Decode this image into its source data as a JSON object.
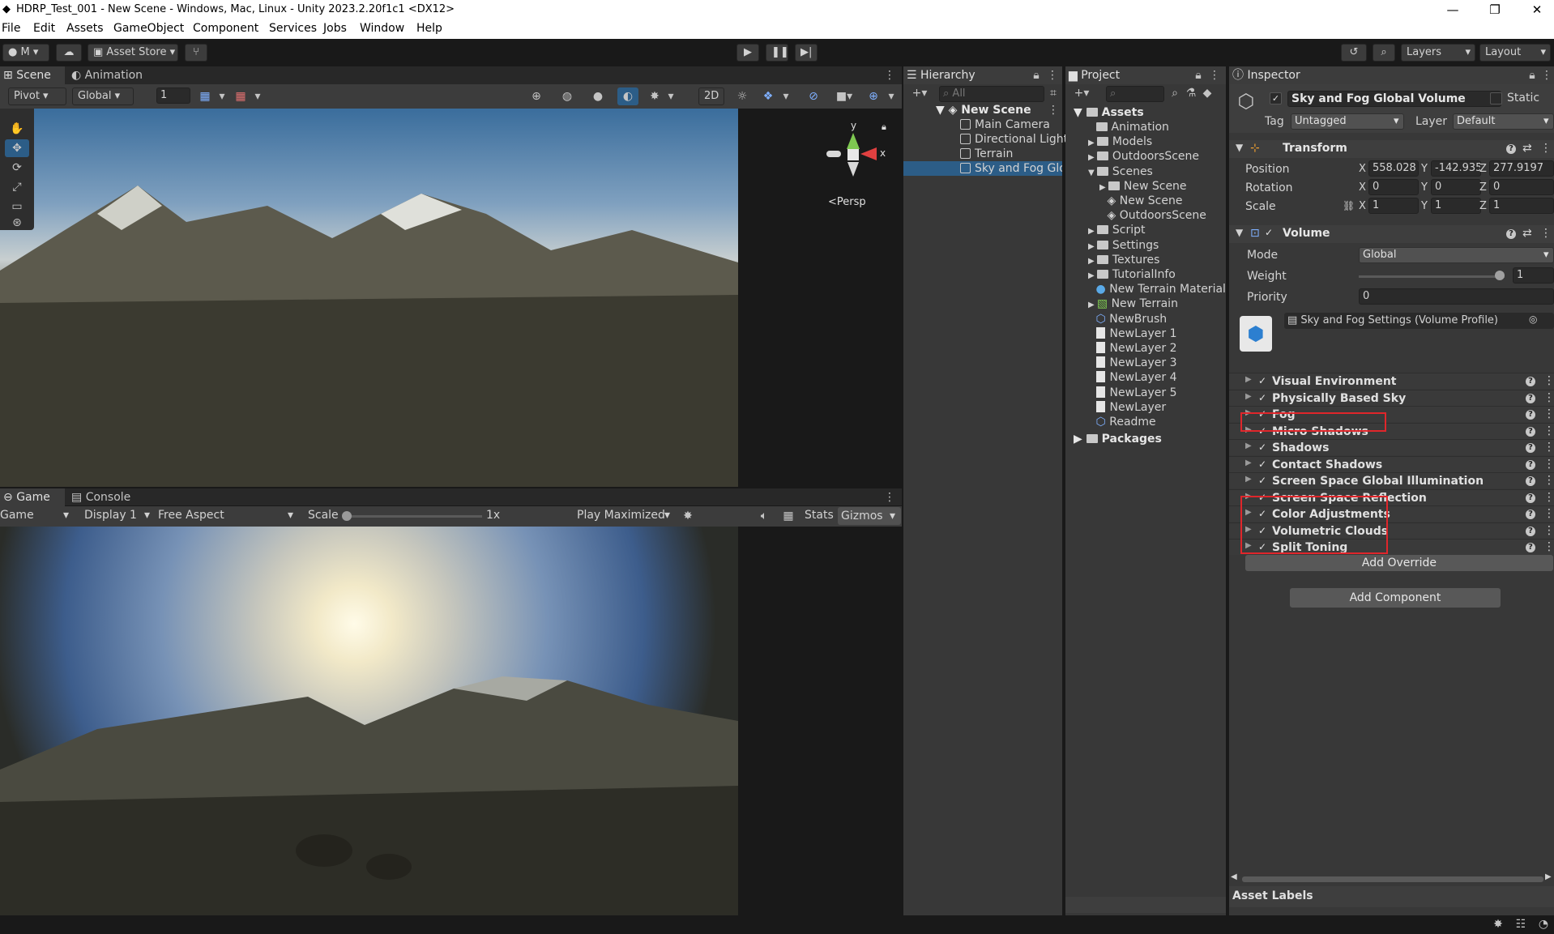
{
  "window": {
    "title": "HDRP_Test_001 - New Scene - Windows, Mac, Linux - Unity 2023.2.20f1c1 <DX12>",
    "minimize": "—",
    "maximize": "❐",
    "close": "✕"
  },
  "menu": [
    "File",
    "Edit",
    "Assets",
    "GameObject",
    "Component",
    "Services",
    "Jobs",
    "Window",
    "Help"
  ],
  "toolbar": {
    "account": "M",
    "asset_store": "Asset Store",
    "layers": "Layers",
    "layout": "Layout"
  },
  "scene": {
    "tab_scene": "Scene",
    "tab_animation": "Animation",
    "pivot": "Pivot",
    "global": "Global",
    "grid_value": "1",
    "mode_2d": "2D",
    "persp": "Persp",
    "gizmo_y": "y",
    "gizmo_x": "x"
  },
  "game": {
    "tab_game": "Game",
    "tab_console": "Console",
    "game_dd": "Game",
    "display": "Display 1",
    "aspect": "Free Aspect",
    "scale_label": "Scale",
    "scale_value": "1x",
    "play_mode": "Play Maximized",
    "stats": "Stats",
    "gizmos": "Gizmos"
  },
  "hierarchy": {
    "title": "Hierarchy",
    "search_placeholder": "All",
    "scene": "New Scene",
    "items": [
      "Main Camera",
      "Directional Light",
      "Terrain",
      "Sky and Fog Glol"
    ]
  },
  "project": {
    "title": "Project",
    "root": "Assets",
    "packages": "Packages",
    "items": [
      {
        "label": "Animation",
        "type": "folder",
        "indent": 1
      },
      {
        "label": "Models",
        "type": "folder",
        "indent": 1
      },
      {
        "label": "OutdoorsScene",
        "type": "folder",
        "indent": 1
      },
      {
        "label": "Scenes",
        "type": "folder",
        "indent": 1
      },
      {
        "label": "New Scene",
        "type": "folder",
        "indent": 2
      },
      {
        "label": "New Scene",
        "type": "scene",
        "indent": 2
      },
      {
        "label": "OutdoorsScene",
        "type": "scene",
        "indent": 2
      },
      {
        "label": "Script",
        "type": "folder",
        "indent": 1
      },
      {
        "label": "Settings",
        "type": "folder",
        "indent": 1
      },
      {
        "label": "Textures",
        "type": "folder",
        "indent": 1
      },
      {
        "label": "TutorialInfo",
        "type": "folder",
        "indent": 1
      },
      {
        "label": "New Terrain Material",
        "type": "material",
        "indent": 1
      },
      {
        "label": "New Terrain",
        "type": "terrain",
        "indent": 1
      },
      {
        "label": "NewBrush",
        "type": "brush",
        "indent": 1
      },
      {
        "label": "NewLayer 1",
        "type": "doc",
        "indent": 1
      },
      {
        "label": "NewLayer 2",
        "type": "doc",
        "indent": 1
      },
      {
        "label": "NewLayer 3",
        "type": "doc",
        "indent": 1
      },
      {
        "label": "NewLayer 4",
        "type": "doc",
        "indent": 1
      },
      {
        "label": "NewLayer 5",
        "type": "doc",
        "indent": 1
      },
      {
        "label": "NewLayer",
        "type": "doc",
        "indent": 1
      },
      {
        "label": "Readme",
        "type": "readme",
        "indent": 1
      }
    ]
  },
  "inspector": {
    "title": "Inspector",
    "object_name": "Sky and Fog Global Volume",
    "static": "Static",
    "tag_label": "Tag",
    "tag_value": "Untagged",
    "layer_label": "Layer",
    "layer_value": "Default",
    "transform": {
      "title": "Transform",
      "position": "Position",
      "rotation": "Rotation",
      "scale": "Scale",
      "pos": [
        "558.028",
        "-142.935",
        "277.9197"
      ],
      "rot": [
        "0",
        "0",
        "0"
      ],
      "scl": [
        "1",
        "1",
        "1"
      ],
      "x": "X",
      "y": "Y",
      "z": "Z"
    },
    "volume": {
      "title": "Volume",
      "mode_label": "Mode",
      "mode_value": "Global",
      "weight_label": "Weight",
      "weight_value": "1",
      "weight_fraction": 1,
      "priority_label": "Priority",
      "priority_value": "0",
      "profile": "Sky and Fog Settings (Volume Profile)"
    },
    "overrides": [
      "Visual Environment",
      "Physically Based Sky",
      "Fog",
      "Micro Shadows",
      "Shadows",
      "Contact Shadows",
      "Screen Space Global Illumination",
      "Screen Space Reflection",
      "Color Adjustments",
      "Volumetric Clouds",
      "Split Toning"
    ],
    "add_override": "Add Override",
    "add_component": "Add Component",
    "asset_labels": "Asset Labels"
  },
  "colors": {
    "highlight": "#e0262b",
    "selection": "#2c5d87"
  }
}
